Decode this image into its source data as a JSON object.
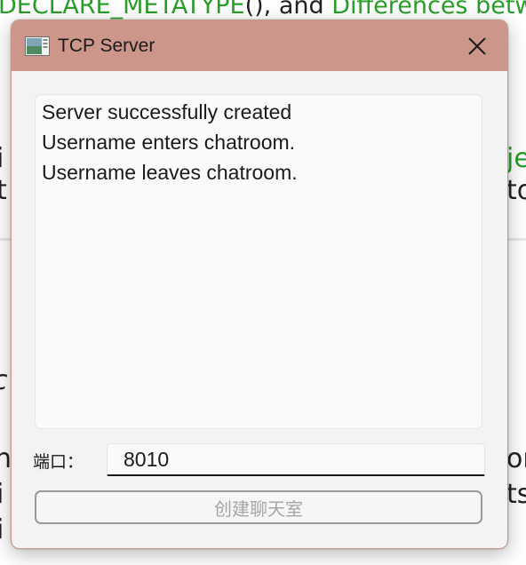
{
  "background": {
    "top_segments": [
      {
        "text": "DECLARE_METATYPE",
        "green": true
      },
      {
        "text": "(), and ",
        "green": false
      },
      {
        "text": "Differences betw",
        "green": true
      }
    ],
    "right_fragments": [
      "je",
      "to",
      "on",
      "ts"
    ],
    "left_fragments": [
      "i",
      "t",
      "c",
      "h",
      "i",
      "i"
    ]
  },
  "window": {
    "title": "TCP Server",
    "close_label": "Close"
  },
  "log": {
    "lines": [
      "Server successfully created",
      "Username enters chatroom.",
      "Username leaves chatroom."
    ]
  },
  "port": {
    "label": "端口：",
    "value": "8010"
  },
  "create_button": {
    "label": "创建聊天室",
    "enabled": false
  }
}
